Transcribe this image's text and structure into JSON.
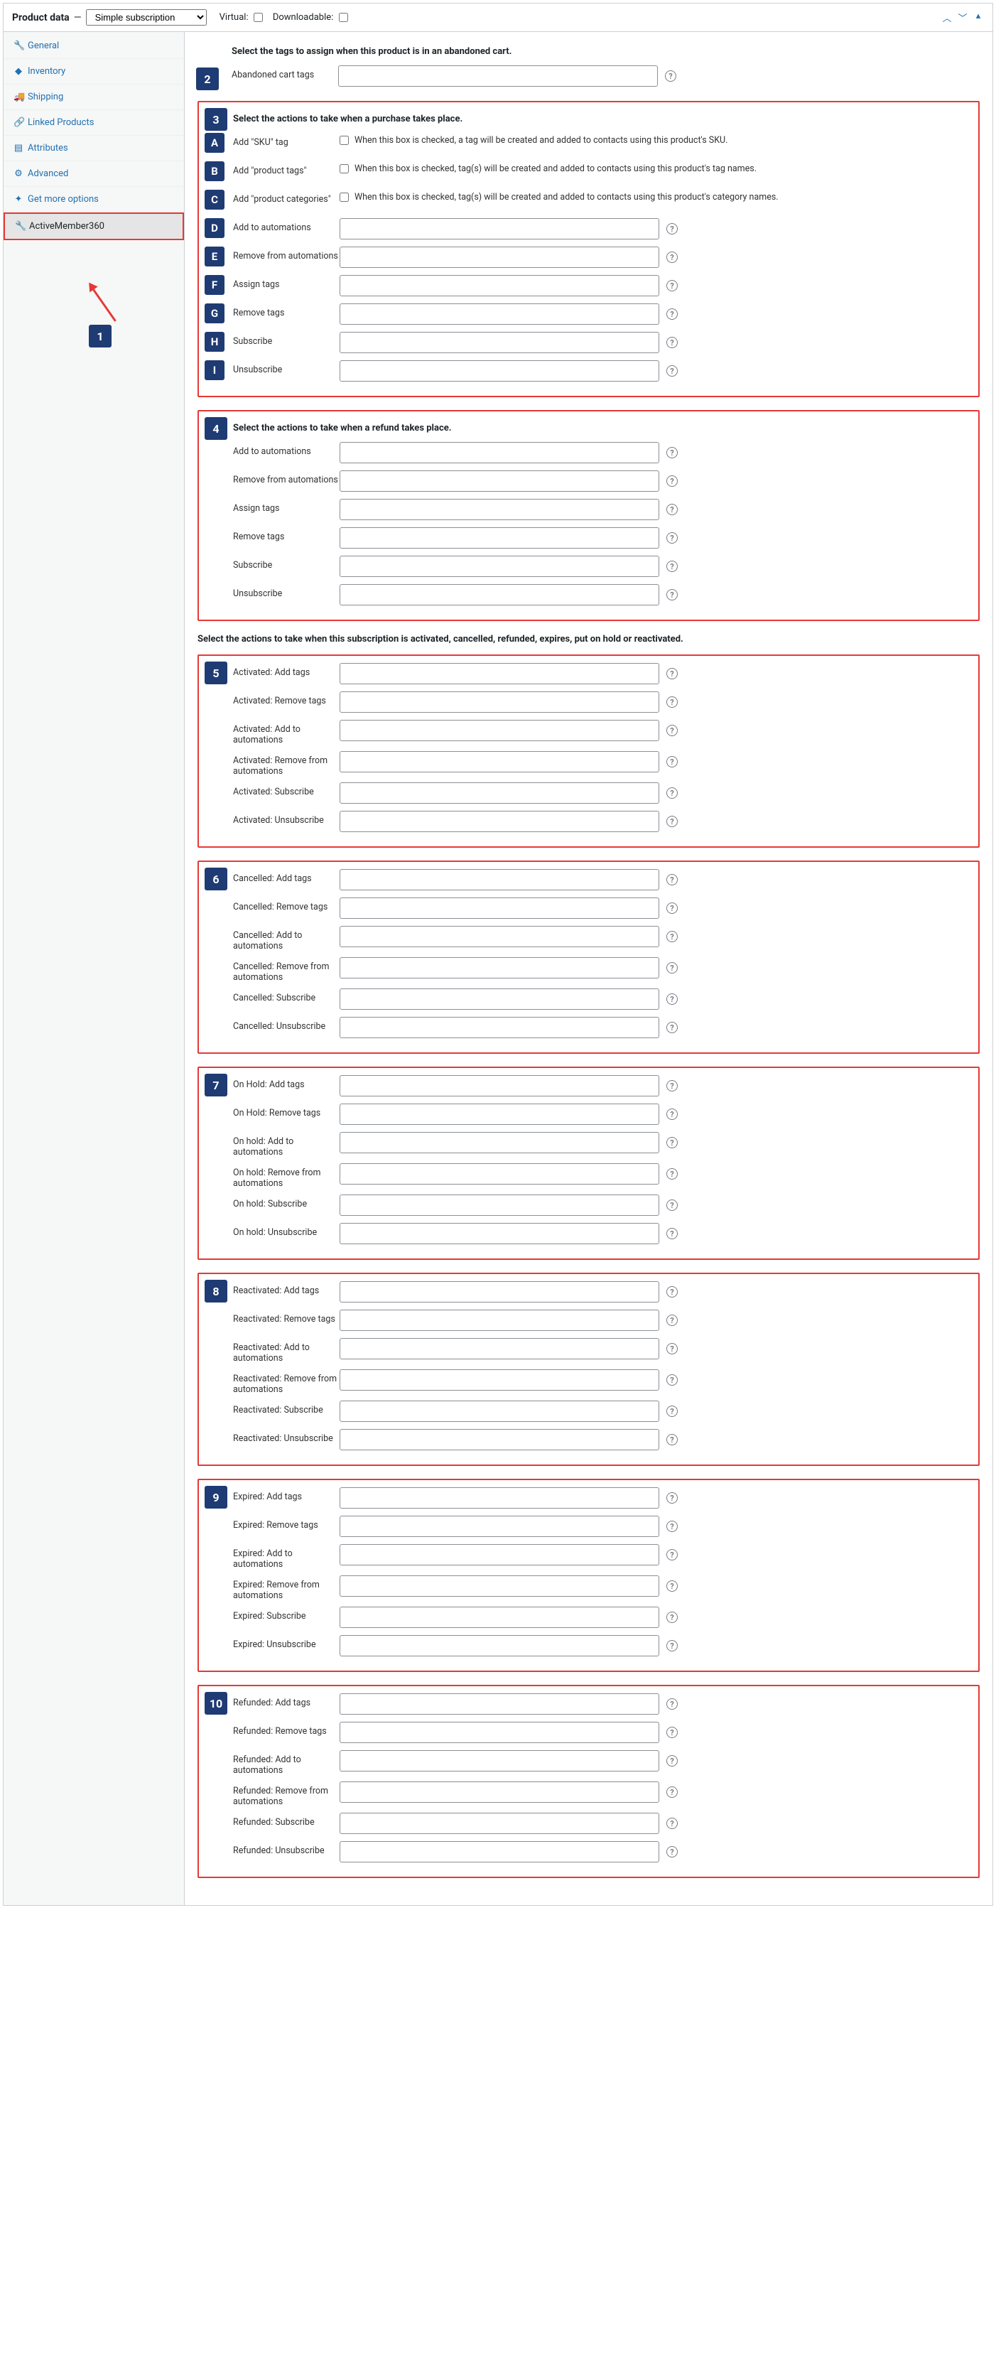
{
  "header": {
    "pd_label": "Product data",
    "dash": "—",
    "select_value": "Simple subscription",
    "virtual_label": "Virtual:",
    "downloadable_label": "Downloadable:"
  },
  "sidebar": {
    "items": [
      {
        "icon": "wrench",
        "label": "General"
      },
      {
        "icon": "db",
        "label": "Inventory"
      },
      {
        "icon": "truck",
        "label": "Shipping"
      },
      {
        "icon": "link",
        "label": "Linked Products"
      },
      {
        "icon": "grid",
        "label": "Attributes"
      },
      {
        "icon": "gear",
        "label": "Advanced"
      },
      {
        "icon": "star",
        "label": "Get more options"
      },
      {
        "icon": "wrench",
        "label": "ActiveMember360"
      }
    ],
    "badge_1": "1"
  },
  "sections": {
    "abandoned": {
      "title": "Select the tags to assign when this product is in an abandoned cart.",
      "badge": "2",
      "row_label": "Abandoned cart tags"
    },
    "purchase": {
      "title": "Select the actions to take when a purchase takes place.",
      "badge": "3",
      "rows": [
        {
          "letter": "A",
          "label": "Add \"SKU\" tag",
          "type": "check",
          "desc": "When this box is checked, a tag will be created and added to contacts using this product's SKU."
        },
        {
          "letter": "B",
          "label": "Add \"product tags\"",
          "type": "check",
          "desc": "When this box is checked, tag(s) will be created and added to contacts using this product's tag names."
        },
        {
          "letter": "C",
          "label": "Add \"product categories\"",
          "type": "check",
          "desc": "When this box is checked, tag(s) will be created and added to contacts using this product's category names."
        },
        {
          "letter": "D",
          "label": "Add to automations",
          "type": "input"
        },
        {
          "letter": "E",
          "label": "Remove from automations",
          "type": "input"
        },
        {
          "letter": "F",
          "label": "Assign tags",
          "type": "input"
        },
        {
          "letter": "G",
          "label": "Remove tags",
          "type": "input"
        },
        {
          "letter": "H",
          "label": "Subscribe",
          "type": "input"
        },
        {
          "letter": "I",
          "label": "Unsubscribe",
          "type": "input"
        }
      ]
    },
    "refund": {
      "title": "Select the actions to take when a refund takes place.",
      "badge": "4",
      "labels": [
        "Add to automations",
        "Remove from automations",
        "Assign tags",
        "Remove tags",
        "Subscribe",
        "Unsubscribe"
      ]
    },
    "sub_title": "Select the actions to take when this subscription is activated, cancelled, refunded, expires, put on hold or reactivated.",
    "groups": [
      {
        "badge": "5",
        "labels": [
          "Activated: Add tags",
          "Activated: Remove tags",
          "Activated: Add to automations",
          "Activated: Remove from automations",
          "Activated: Subscribe",
          "Activated: Unsubscribe"
        ]
      },
      {
        "badge": "6",
        "labels": [
          "Cancelled: Add tags",
          "Cancelled: Remove tags",
          "Cancelled: Add to automations",
          "Cancelled: Remove from automations",
          "Cancelled: Subscribe",
          "Cancelled: Unsubscribe"
        ]
      },
      {
        "badge": "7",
        "labels": [
          "On Hold: Add tags",
          "On Hold: Remove tags",
          "On hold: Add to automations",
          "On hold: Remove from automations",
          "On hold: Subscribe",
          "On hold: Unsubscribe"
        ]
      },
      {
        "badge": "8",
        "labels": [
          "Reactivated: Add tags",
          "Reactivated: Remove tags",
          "Reactivated: Add to automations",
          "Reactivated: Remove from automations",
          "Reactivated: Subscribe",
          "Reactivated: Unsubscribe"
        ]
      },
      {
        "badge": "9",
        "labels": [
          "Expired: Add tags",
          "Expired: Remove tags",
          "Expired: Add to automations",
          "Expired: Remove from automations",
          "Expired: Subscribe",
          "Expired: Unsubscribe"
        ]
      },
      {
        "badge": "10",
        "labels": [
          "Refunded: Add tags",
          "Refunded: Remove tags",
          "Refunded: Add to automations",
          "Refunded: Remove from automations",
          "Refunded: Subscribe",
          "Refunded: Unsubscribe"
        ]
      }
    ]
  },
  "icons": {
    "wrench": "🔧",
    "db": "◆",
    "truck": "🚚",
    "link": "🔗",
    "grid": "▤",
    "gear": "⚙",
    "star": "✦",
    "chev_up": "︿",
    "chev_down": "﹀",
    "tri": "▴",
    "help": "?"
  }
}
